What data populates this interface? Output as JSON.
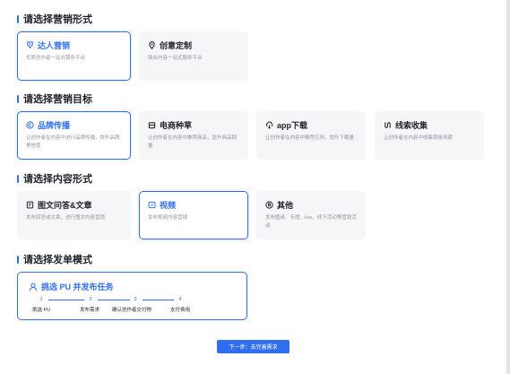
{
  "sections": {
    "form": {
      "title": "请选择营销形式",
      "cards": [
        {
          "title": "达人营销",
          "desc": "优质创作者一站式服务平台",
          "icon": "badge-icon",
          "selected": true
        },
        {
          "title": "创意定制",
          "desc": "商业内容一站式服务平台",
          "icon": "location-pin-icon",
          "selected": false
        }
      ]
    },
    "goal": {
      "title": "请选择营销目标",
      "cards": [
        {
          "title": "品牌传播",
          "desc": "让创作者在内容中进行品牌传播，提升品牌美誉度",
          "icon": "copyright-circle-icon",
          "selected": true
        },
        {
          "title": "电商种草",
          "desc": "让创作者在内容中推荐商品，提升商品销量",
          "icon": "shop-icon",
          "selected": false
        },
        {
          "title": "app下载",
          "desc": "让创作者在内容中推荐应用，提升下载量",
          "icon": "cloud-download-icon",
          "selected": false
        },
        {
          "title": "线索收集",
          "desc": "让创作者在内容中收集销售线索",
          "icon": "lead-icon",
          "selected": false
        }
      ]
    },
    "content": {
      "title": "请选择内容形式",
      "cards": [
        {
          "title": "图文问答&文章",
          "desc": "发布回答或文章，进行图文内容营销",
          "icon": "article-icon",
          "selected": false
        },
        {
          "title": "视频",
          "desc": "发布视频内容营销",
          "icon": "video-icon",
          "selected": true
        },
        {
          "title": "其他",
          "desc": "发布圆桌、专题、live、线下活动等营销活动",
          "icon": "registered-icon",
          "selected": false
        }
      ]
    },
    "order": {
      "title": "请选择发单模式",
      "card": {
        "title": "挑选 PU 并发布任务",
        "icon": "person-icon",
        "steps": [
          {
            "num": "1",
            "label": "挑选 PU"
          },
          {
            "num": "2",
            "label": "发布需求"
          },
          {
            "num": "3",
            "label": "确认创作者交付物"
          },
          {
            "num": "4",
            "label": "支付费用"
          }
        ]
      }
    }
  },
  "next_button": "下一步：去完善需求",
  "colors": {
    "accent": "#2f6fed",
    "card_bg": "#f5f6f7",
    "muted": "#8f959e"
  }
}
